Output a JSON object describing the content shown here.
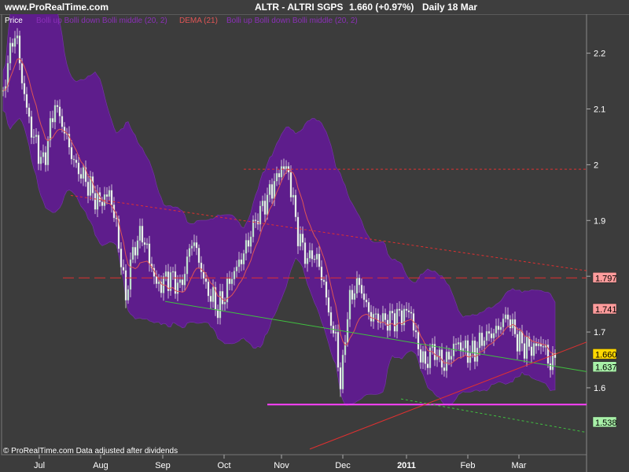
{
  "header": {
    "site": "www.ProRealTime.com",
    "instrument": "ALTR - ALTRI SGPS",
    "quote": "1.660 (+0.97%)",
    "period": "Daily 18 Mar"
  },
  "panel": {
    "label": "Price",
    "legend": [
      {
        "text": "Bolli up Bolli down Bolli middle (20, 2)",
        "color": "#8b2fb8"
      },
      {
        "text": "DEMA (21)",
        "color": "#e05555"
      },
      {
        "text": "Bolli up Bolli down Bolli middle (20, 2)",
        "color": "#8b2fb8"
      }
    ],
    "footer": "© ProRealTime.com  Data adjusted after dividends"
  },
  "colors": {
    "background": "#3c3c3c",
    "band": "#5e1d8c",
    "up_candle": "#c8ead8",
    "down_candle": "#ffffff",
    "dema": "#e05555",
    "resistance": "#e03030",
    "support": "#40c040",
    "horizontal_support": "#ff40ff"
  },
  "chart_data": {
    "type": "candlestick",
    "x": [
      "Jul",
      "Aug",
      "Sep",
      "Oct",
      "Nov",
      "Dec",
      "2011",
      "Feb",
      "Mar"
    ],
    "y_ticks": [
      1.6,
      1.7,
      1.8,
      1.9,
      2,
      2.1,
      2.2
    ],
    "ylim": [
      1.48,
      2.27
    ],
    "price_path": [
      [
        0,
        2.09
      ],
      [
        12,
        2.2
      ],
      [
        20,
        2.24
      ],
      [
        30,
        2.13
      ],
      [
        40,
        2.06
      ],
      [
        55,
        2.0
      ],
      [
        70,
        2.11
      ],
      [
        82,
        2.06
      ],
      [
        95,
        2.0
      ],
      [
        110,
        1.97
      ],
      [
        125,
        1.93
      ],
      [
        140,
        1.95
      ],
      [
        150,
        1.87
      ],
      [
        160,
        1.76
      ],
      [
        168,
        1.84
      ],
      [
        180,
        1.88
      ],
      [
        200,
        1.78
      ],
      [
        215,
        1.8
      ],
      [
        230,
        1.78
      ],
      [
        245,
        1.87
      ],
      [
        262,
        1.78
      ],
      [
        278,
        1.74
      ],
      [
        295,
        1.8
      ],
      [
        310,
        1.84
      ],
      [
        325,
        1.9
      ],
      [
        340,
        1.94
      ],
      [
        350,
        1.97
      ],
      [
        360,
        2.0
      ],
      [
        368,
        1.98
      ],
      [
        378,
        1.88
      ],
      [
        390,
        1.83
      ],
      [
        400,
        1.84
      ],
      [
        410,
        1.8
      ],
      [
        420,
        1.72
      ],
      [
        428,
        1.68
      ],
      [
        434,
        1.59
      ],
      [
        440,
        1.72
      ],
      [
        448,
        1.77
      ],
      [
        456,
        1.79
      ],
      [
        470,
        1.73
      ],
      [
        490,
        1.72
      ],
      [
        510,
        1.73
      ],
      [
        522,
        1.74
      ],
      [
        530,
        1.68
      ],
      [
        540,
        1.64
      ],
      [
        550,
        1.67
      ],
      [
        565,
        1.64
      ],
      [
        580,
        1.68
      ],
      [
        600,
        1.66
      ],
      [
        615,
        1.69
      ],
      [
        630,
        1.7
      ],
      [
        645,
        1.73
      ],
      [
        660,
        1.68
      ],
      [
        675,
        1.67
      ],
      [
        690,
        1.68
      ],
      [
        700,
        1.64
      ],
      [
        708,
        1.66
      ]
    ],
    "horizontal_lines": [
      {
        "y": 1.992,
        "color": "#e03030",
        "style": "dotted"
      },
      {
        "y": 1.797,
        "color": "#e03030",
        "style": "dashed"
      },
      {
        "y": 1.57,
        "color": "#ff40ff",
        "style": "solid"
      }
    ],
    "trend_lines": [
      {
        "from": [
          "Jul",
          1.945
        ],
        "to": [
          "end",
          1.81
        ],
        "color": "#e03030",
        "style": "dotted"
      },
      {
        "from": [
          "Sep",
          1.755
        ],
        "to": [
          "end",
          1.629
        ],
        "color": "#40c040",
        "style": "solid"
      },
      {
        "from": [
          "Nov",
          1.49
        ],
        "to": [
          "end",
          1.682
        ],
        "color": "#e03030",
        "style": "solid"
      },
      {
        "from": [
          "2011",
          1.58
        ],
        "to": [
          "end",
          1.52
        ],
        "color": "#40c040",
        "style": "dotted"
      }
    ],
    "price_labels": [
      {
        "text": "1.797",
        "bg": "#ff9c9c",
        "fg": "#000000"
      },
      {
        "text": "1.741",
        "bg": "#ff9c9c",
        "fg": "#000000"
      },
      {
        "text": "1.660",
        "bg": "#ffd700",
        "fg": "#000000"
      },
      {
        "text": "1.637",
        "bg": "#a8f0a8",
        "fg": "#000000"
      },
      {
        "text": "1.538",
        "bg": "#a8f0a8",
        "fg": "#000000"
      }
    ]
  }
}
